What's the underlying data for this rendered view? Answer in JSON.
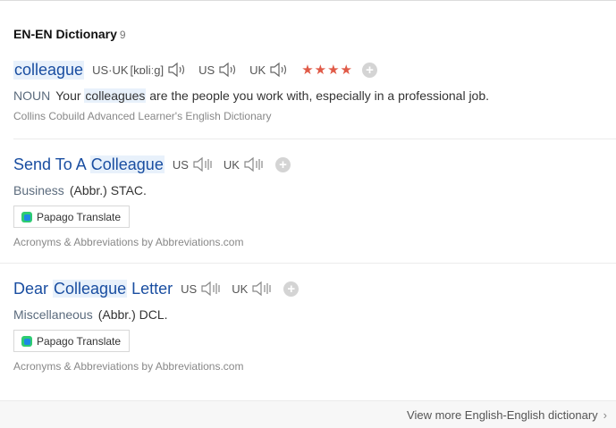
{
  "section": {
    "title": "EN-EN Dictionary",
    "count": "9"
  },
  "entry1": {
    "word": "colleague",
    "pron_us_uk_label": "US·UK",
    "pron_text": "[kɒliːg]",
    "us_label": "US",
    "uk_label": "UK",
    "stars": "★★★★",
    "pos": "NOUN",
    "def_before": "Your",
    "def_highlight": "colleagues",
    "def_after": "are the people you work with, especially in a professional job.",
    "source": "Collins Cobuild Advanced Learner's English Dictionary"
  },
  "entry2": {
    "title_before": "Send To A",
    "title_highlight": "Colleague",
    "us_label": "US",
    "uk_label": "UK",
    "category": "Business",
    "abbr": "(Abbr.) STAC.",
    "papago_label": "Papago Translate",
    "source": "Acronyms & Abbreviations by Abbreviations.com"
  },
  "entry3": {
    "title_before": "Dear",
    "title_highlight": "Colleague",
    "title_after": "Letter",
    "us_label": "US",
    "uk_label": "UK",
    "category": "Miscellaneous",
    "abbr": "(Abbr.) DCL.",
    "papago_label": "Papago Translate",
    "source": "Acronyms & Abbreviations by Abbreviations.com"
  },
  "footer": {
    "view_more": "View more English-English dictionary"
  },
  "icons": {
    "speaker": "speaker-icon",
    "plus": "plus-icon",
    "papago": "papago-logo-icon",
    "chevron": "chevron-right-icon"
  },
  "colors": {
    "link": "#1a4ea1",
    "star": "#e05a47",
    "highlight": "#e8f1fb"
  }
}
